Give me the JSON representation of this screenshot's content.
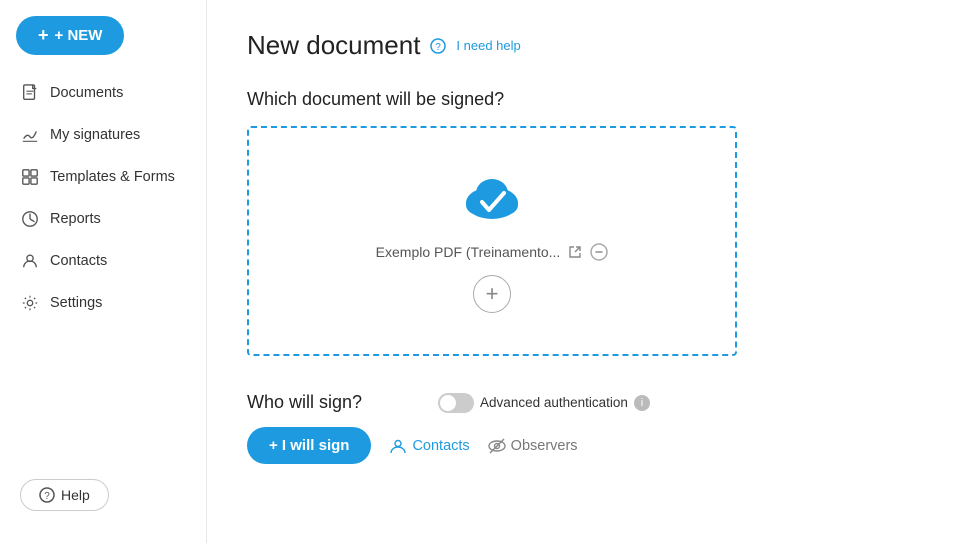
{
  "sidebar": {
    "new_button": "+ NEW",
    "items": [
      {
        "id": "documents",
        "label": "Documents",
        "icon": "document-icon"
      },
      {
        "id": "my-signatures",
        "label": "My signatures",
        "icon": "signature-icon"
      },
      {
        "id": "templates-forms",
        "label": "Templates & Forms",
        "icon": "templates-icon"
      },
      {
        "id": "reports",
        "label": "Reports",
        "icon": "reports-icon"
      },
      {
        "id": "contacts",
        "label": "Contacts",
        "icon": "contacts-icon"
      },
      {
        "id": "settings",
        "label": "Settings",
        "icon": "settings-icon"
      }
    ],
    "help_button": "Help"
  },
  "main": {
    "page_title": "New document",
    "help_link": "I need help",
    "section_which": "Which document will be signed?",
    "file_name": "Exemplo PDF (Treinamento...",
    "add_more_label": "+",
    "section_who": "Who will sign?",
    "auth_label": "Advanced authentication",
    "i_will_sign": "+ I will sign",
    "contacts_label": "Contacts",
    "observers_label": "Observers"
  },
  "colors": {
    "accent": "#1e9be0",
    "text_dark": "#222",
    "text_muted": "#777",
    "border_dashed": "#1e9be0"
  }
}
